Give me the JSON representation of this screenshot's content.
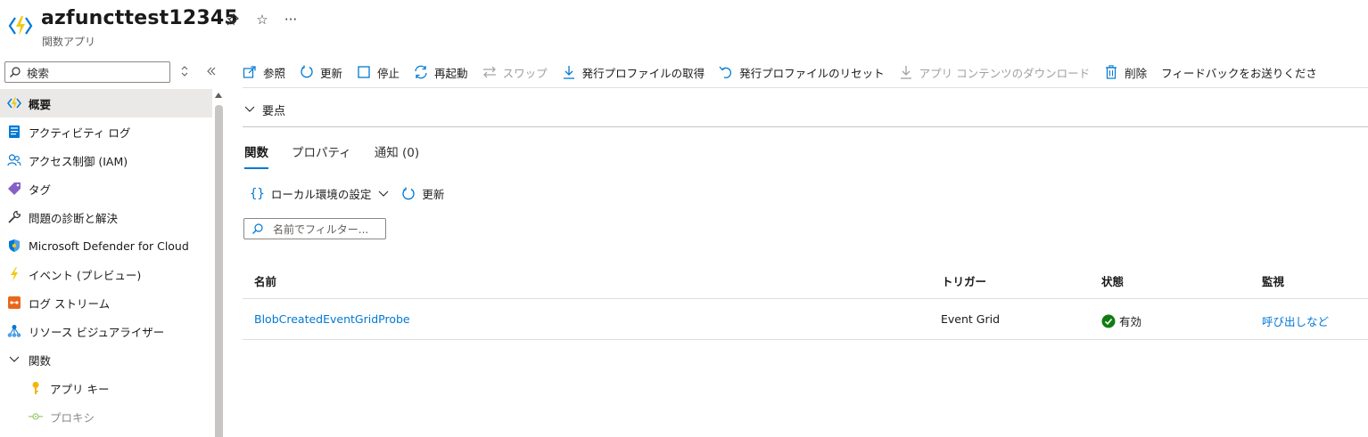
{
  "header": {
    "title": "azfuncttest12345",
    "subtitle": "関数アプリ",
    "more": "···"
  },
  "sidebar": {
    "search_label": "検索",
    "items": [
      {
        "label": "概要"
      },
      {
        "label": "アクティビティ ログ"
      },
      {
        "label": "アクセス制御 (IAM)"
      },
      {
        "label": "タグ"
      },
      {
        "label": "問題の診断と解決"
      },
      {
        "label": "Microsoft Defender for Cloud"
      },
      {
        "label": "イベント (プレビュー)"
      },
      {
        "label": "ログ ストリーム"
      },
      {
        "label": "リソース ビジュアライザー"
      },
      {
        "label": "関数"
      },
      {
        "label": "アプリ キー"
      },
      {
        "label": "プロキシ"
      }
    ]
  },
  "toolbar": {
    "browse": "参照",
    "refresh": "更新",
    "stop": "停止",
    "restart": "再起動",
    "swap": "スワップ",
    "get_profile": "発行プロファイルの取得",
    "reset_profile": "発行プロファイルのリセット",
    "download": "アプリ コンテンツのダウンロード",
    "delete": "削除",
    "feedback": "フィードバックをお送りくださ"
  },
  "essentials": {
    "label": "要点"
  },
  "tabs": [
    {
      "label": "関数"
    },
    {
      "label": "プロパティ"
    },
    {
      "label": "通知 (0)"
    }
  ],
  "subtoolbar": {
    "local_env": "ローカル環境の設定",
    "refresh": "更新"
  },
  "filter": {
    "placeholder": "名前でフィルター..."
  },
  "table": {
    "columns": [
      "名前",
      "トリガー",
      "状態",
      "監視"
    ],
    "rows": [
      {
        "name": "BlobCreatedEventGridProbe",
        "trigger": "Event Grid",
        "status": "有効",
        "monitor": "呼び出しなど"
      }
    ]
  },
  "colors": {
    "accent": "#0078d4",
    "success": "#107c10",
    "active_bg": "#ebe9e7"
  }
}
